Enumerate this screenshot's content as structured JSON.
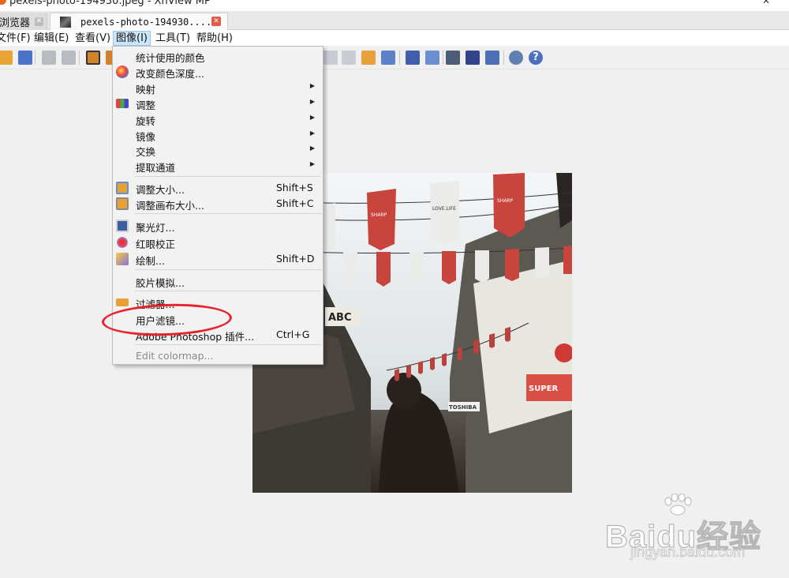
{
  "window": {
    "title": "pexels-photo-194930.jpeg - XnView MP",
    "close_glyph": "✕"
  },
  "tabs": [
    {
      "label": "浏览器"
    },
    {
      "label": "pexels-photo-194930...."
    }
  ],
  "menubar": [
    {
      "label": "文件(F)"
    },
    {
      "label": "编辑(E)"
    },
    {
      "label": "查看(V)"
    },
    {
      "label": "图像(I)"
    },
    {
      "label": "工具(T)"
    },
    {
      "label": "帮助(H)"
    }
  ],
  "image_menu": {
    "items": [
      {
        "label": "统计使用的颜色",
        "shortcut": "",
        "icon": "none"
      },
      {
        "label": "改变颜色深度...",
        "shortcut": "",
        "icon": "color-depth-icon"
      },
      {
        "label": "映射",
        "shortcut": "",
        "icon": "none",
        "submenu": true
      },
      {
        "label": "调整",
        "shortcut": "",
        "icon": "adjust-icon",
        "submenu": true
      },
      {
        "label": "旋转",
        "shortcut": "",
        "icon": "none",
        "submenu": true
      },
      {
        "label": "镜像",
        "shortcut": "",
        "icon": "none",
        "submenu": true
      },
      {
        "label": "交换",
        "shortcut": "",
        "icon": "none",
        "submenu": true
      },
      {
        "label": "提取通道",
        "shortcut": "",
        "icon": "none",
        "submenu": true
      },
      {
        "label": "调整大小...",
        "shortcut": "Shift+S",
        "icon": "resize-icon"
      },
      {
        "label": "调整画布大小...",
        "shortcut": "Shift+C",
        "icon": "canvas-size-icon"
      },
      {
        "label": "聚光灯...",
        "shortcut": "",
        "icon": "spotlight-icon"
      },
      {
        "label": "红眼校正",
        "shortcut": "",
        "icon": "red-eye-icon"
      },
      {
        "label": "绘制...",
        "shortcut": "Shift+D",
        "icon": "draw-icon"
      },
      {
        "label": "胶片模拟...",
        "shortcut": "",
        "icon": "none"
      },
      {
        "label": "过滤器...",
        "shortcut": "",
        "icon": "filter-icon"
      },
      {
        "label": "用户滤镜...",
        "shortcut": "",
        "icon": "none"
      },
      {
        "label": "Adobe Photoshop 插件...",
        "shortcut": "Ctrl+G",
        "icon": "none"
      },
      {
        "label": "Edit colormap...",
        "shortcut": "",
        "icon": "none",
        "disabled": true
      }
    ],
    "submenu_glyph": "▶"
  },
  "photo": {
    "banner_texts": [
      "SHARP",
      "LOVE.LIFE",
      "SHARP"
    ],
    "sign_texts": [
      "ABC",
      "TOSHIBA",
      "SUPER"
    ]
  },
  "watermark": {
    "brand": "Baidu经验",
    "site": "jingyan.baidu.com"
  },
  "colors": {
    "annotation": "#e8232c",
    "menu_active_bg": "#cce4f7",
    "banner_red": "#c8453e"
  }
}
